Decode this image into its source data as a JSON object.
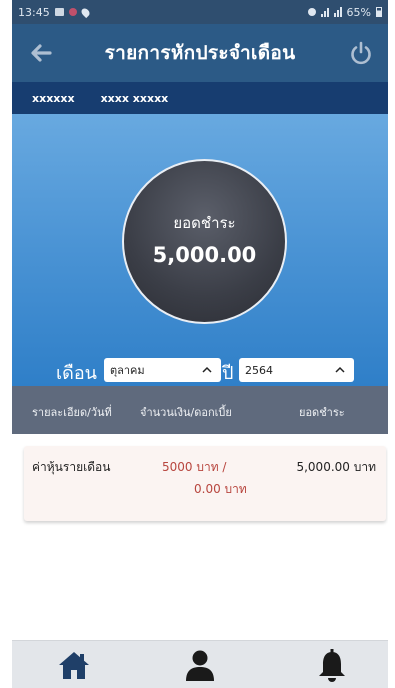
{
  "status_bar": {
    "time": "13:45",
    "battery": "65%"
  },
  "app_bar": {
    "title": "รายการหักประจำเดือน",
    "back_icon": "arrow-left-icon",
    "power_icon": "power-icon"
  },
  "user": {
    "member_id": "xxxxxx",
    "member_name": "xxxx xxxxx"
  },
  "summary": {
    "label": "ยอดชำระ",
    "amount": "5,000.00"
  },
  "filter": {
    "month_label": "เดือน",
    "month_value": "ตุลาคม",
    "year_label": "ปี",
    "year_value": "2564"
  },
  "table": {
    "headers": [
      "รายละเอียด/วันที่",
      "จำนวนเงิน/ดอกเบี้ย",
      "ยอดชำระ"
    ],
    "rows": [
      {
        "description": "ค่าหุ้นรายเดือน",
        "amount_line1": "5000 บาท /",
        "amount_line2": "0.00 บาท",
        "total": "5,000.00 บาท"
      }
    ]
  },
  "bottom_nav": {
    "items": [
      "home-icon",
      "user-icon",
      "bell-icon"
    ]
  },
  "colors": {
    "header": "#2c5a86",
    "user_bar": "#173d70",
    "hero_top": "#68a9e0",
    "hero_bottom": "#2f7fc8",
    "table_header": "#5f6a7d",
    "amount_red": "#b8463f"
  }
}
